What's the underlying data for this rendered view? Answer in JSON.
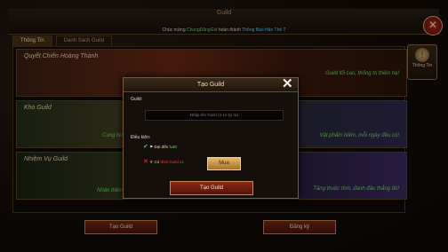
{
  "window": {
    "title": "Guild",
    "close_icon": "close-icon"
  },
  "ticker": {
    "prefix": "Chúc mừng ",
    "player": "ChungDũngGiỏ",
    "middle": " hoàn thành ",
    "achievement": "Thông Báo Hăn Thế T",
    "full": "Chúc mừng ChungDũngGiỏ hoàn thành Thông Báo Hăn Thế T"
  },
  "tabs": [
    {
      "label": "Thông Tin",
      "active": true
    },
    {
      "label": "Danh Sách Guild",
      "active": false
    }
  ],
  "banners": [
    {
      "title": "Quyết Chiến Hoàng Thành",
      "desc": "Guild tối cao, thống trị thiên hạ!"
    },
    {
      "title": "Kho Guild",
      "desc": "Vật phẩm hiếm, mỗi ngày đều có!",
      "left_desc": "Cung hươ"
    },
    {
      "title": "Nhiệm Vụ Guild",
      "desc": "Tăng thuộc tính, đánh đâu thắng đó!",
      "left_desc": "Nhận thêm EXP, cống hiến các nhiệm"
    }
  ],
  "side_button": {
    "label": "Thông Tin",
    "icon": "info-icon"
  },
  "bottom_buttons": {
    "create": "Tạo Guild",
    "register": "Đăng ký"
  },
  "dialog": {
    "title": "Tạo Guild",
    "guild_label": "Guild:",
    "name_placeholder": "Nhập tên Guild (4-10 ký tự)",
    "conditions_label": "Điều kiện:",
    "condition1": {
      "status": "ok",
      "prefix": "Đạt đến ",
      "value": "lv40"
    },
    "condition2": {
      "status": "fail",
      "prefix": "Có ",
      "value": "lệnh Guild x1"
    },
    "buy_label": "Mua",
    "create_label": "Tạo Guild"
  },
  "colors": {
    "accent_green": "#6de35a",
    "accent_red": "#e0402a",
    "gold": "#e7b86a"
  }
}
